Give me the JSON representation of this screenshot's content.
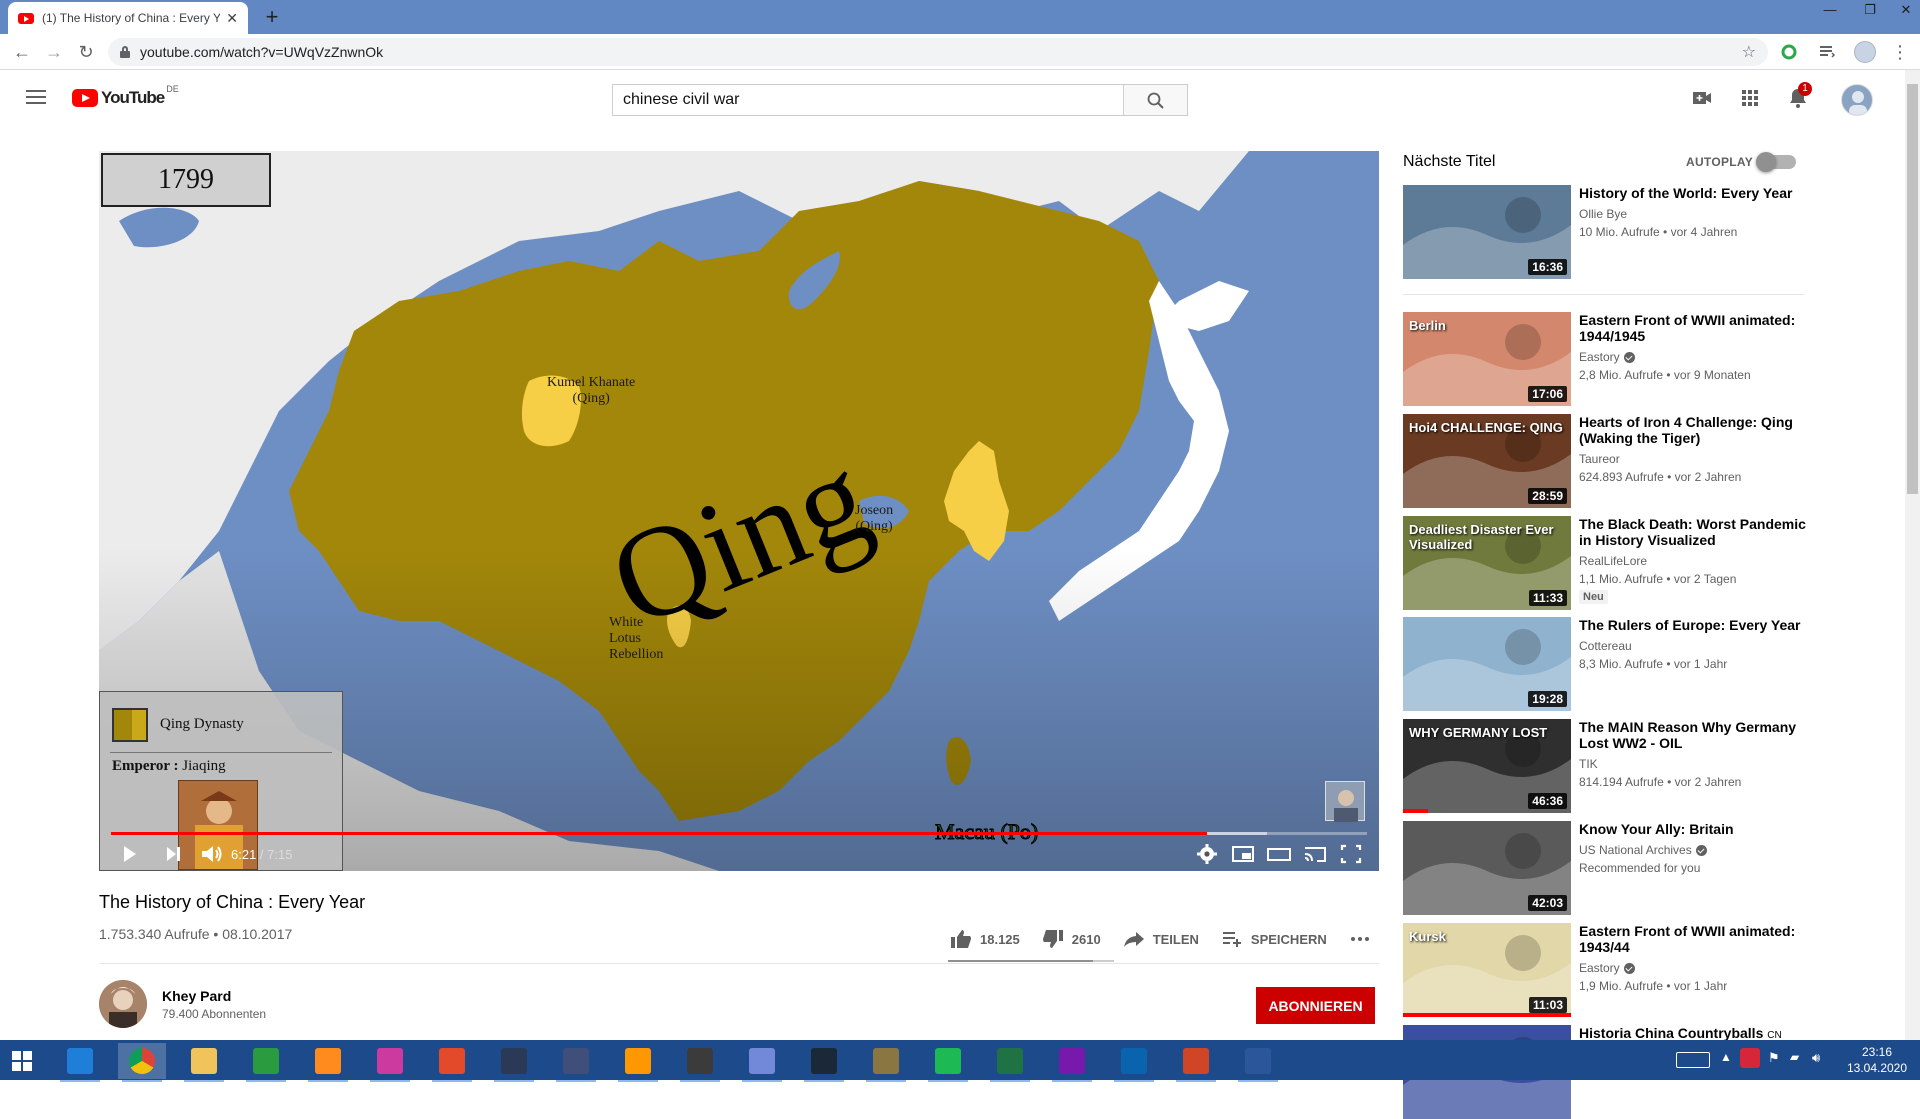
{
  "browser": {
    "tab_title": "(1) The History of China : Every Year",
    "url": "youtube.com/watch?v=UWqVzZnwnOk"
  },
  "youtube": {
    "logo_word": "YouTube",
    "country": "DE",
    "search_query": "chinese civil war",
    "notification_count": "1"
  },
  "video": {
    "year": "1799",
    "labels": {
      "qing": "Qing",
      "kumel": "Kumel Khanate\n(Qing)",
      "joseon": "Joseon\n(Qing)",
      "white_lotus": "White\nLotus\nRebellion",
      "macau": "Macau (Po)"
    },
    "legend": {
      "dynasty": "Qing Dynasty",
      "emperor_label": "Emperor :",
      "emperor_name": "Jiaqing"
    },
    "time_current": "6:21",
    "time_separator": " / ",
    "time_total": "7:15",
    "progress_fraction": 0.873,
    "buffered_fraction": 0.92
  },
  "info": {
    "title": "The History of China : Every Year",
    "meta": "1.753.340 Aufrufe • 08.10.2017",
    "likes": "18.125",
    "dislikes": "2610",
    "share": "TEILEN",
    "save": "SPEICHERN",
    "like_ratio": 0.874,
    "channel": "Khey Pard",
    "subscribers": "79.400 Abonnenten",
    "subscribe": "ABONNIEREN"
  },
  "sidebar": {
    "heading": "Nächste Titel",
    "autoplay": "AUTOPLAY",
    "items": [
      {
        "title": "History of the World: Every Year",
        "channel": "Ollie Bye",
        "verified": false,
        "stats": "10 Mio. Aufrufe • vor 4 Jahren",
        "duration": "16:36",
        "badge": "",
        "watched": 0,
        "thumb_color": "#5d7a96"
      },
      {
        "title": "Eastern Front of WWII animated: 1944/1945",
        "channel": "Eastory",
        "verified": true,
        "stats": "2,8 Mio. Aufrufe • vor 9 Monaten",
        "duration": "17:06",
        "badge": "",
        "watched": 0,
        "thumb_color": "#d3876c",
        "thumb_text": "Berlin"
      },
      {
        "title": "Hearts of Iron 4 Challenge: Qing (Waking the Tiger)",
        "channel": "Taureor",
        "verified": false,
        "stats": "624.893 Aufrufe • vor 2 Jahren",
        "duration": "28:59",
        "badge": "",
        "watched": 0,
        "thumb_color": "#6a3a22",
        "thumb_text": "Hoi4 CHALLENGE: QING"
      },
      {
        "title": "The Black Death: Worst Pandemic in History Visualized",
        "channel": "RealLifeLore",
        "verified": false,
        "stats": "1,1 Mio. Aufrufe • vor 2 Tagen",
        "duration": "11:33",
        "badge": "Neu",
        "watched": 0,
        "thumb_color": "#6f7a3c",
        "thumb_text": "Deadliest Disaster Ever Visualized"
      },
      {
        "title": "The Rulers of Europe: Every Year",
        "channel": "Cottereau",
        "verified": false,
        "stats": "8,3 Mio. Aufrufe • vor 1 Jahr",
        "duration": "19:28",
        "badge": "",
        "watched": 0,
        "thumb_color": "#8fb2cf"
      },
      {
        "title": "The MAIN Reason Why Germany Lost WW2 - OIL",
        "channel": "TIK",
        "verified": false,
        "stats": "814.194 Aufrufe • vor 2 Jahren",
        "duration": "46:36",
        "badge": "",
        "watched": 0.15,
        "thumb_color": "#2f2f2f",
        "thumb_text": "WHY GERMANY LOST"
      },
      {
        "title": "Know Your Ally: Britain",
        "channel": "US National Archives",
        "verified": true,
        "stats": "Recommended for you",
        "duration": "42:03",
        "badge": "",
        "watched": 0,
        "thumb_color": "#5a5a5a"
      },
      {
        "title": "Eastern Front of WWII animated: 1943/44",
        "channel": "Eastory",
        "verified": true,
        "stats": "1,9 Mio. Aufrufe • vor 1 Jahr",
        "duration": "11:03",
        "badge": "",
        "watched": 1,
        "thumb_color": "#e2d7a8",
        "thumb_text": "Kursk"
      },
      {
        "title": "Historia China Countryballs",
        "channel": "",
        "verified": false,
        "stats": "",
        "duration": "",
        "badge": "",
        "watched": 0,
        "thumb_color": "#3a4fa0",
        "flag": "CN"
      }
    ]
  },
  "taskbar": {
    "time": "23:16",
    "date": "13.04.2020"
  }
}
